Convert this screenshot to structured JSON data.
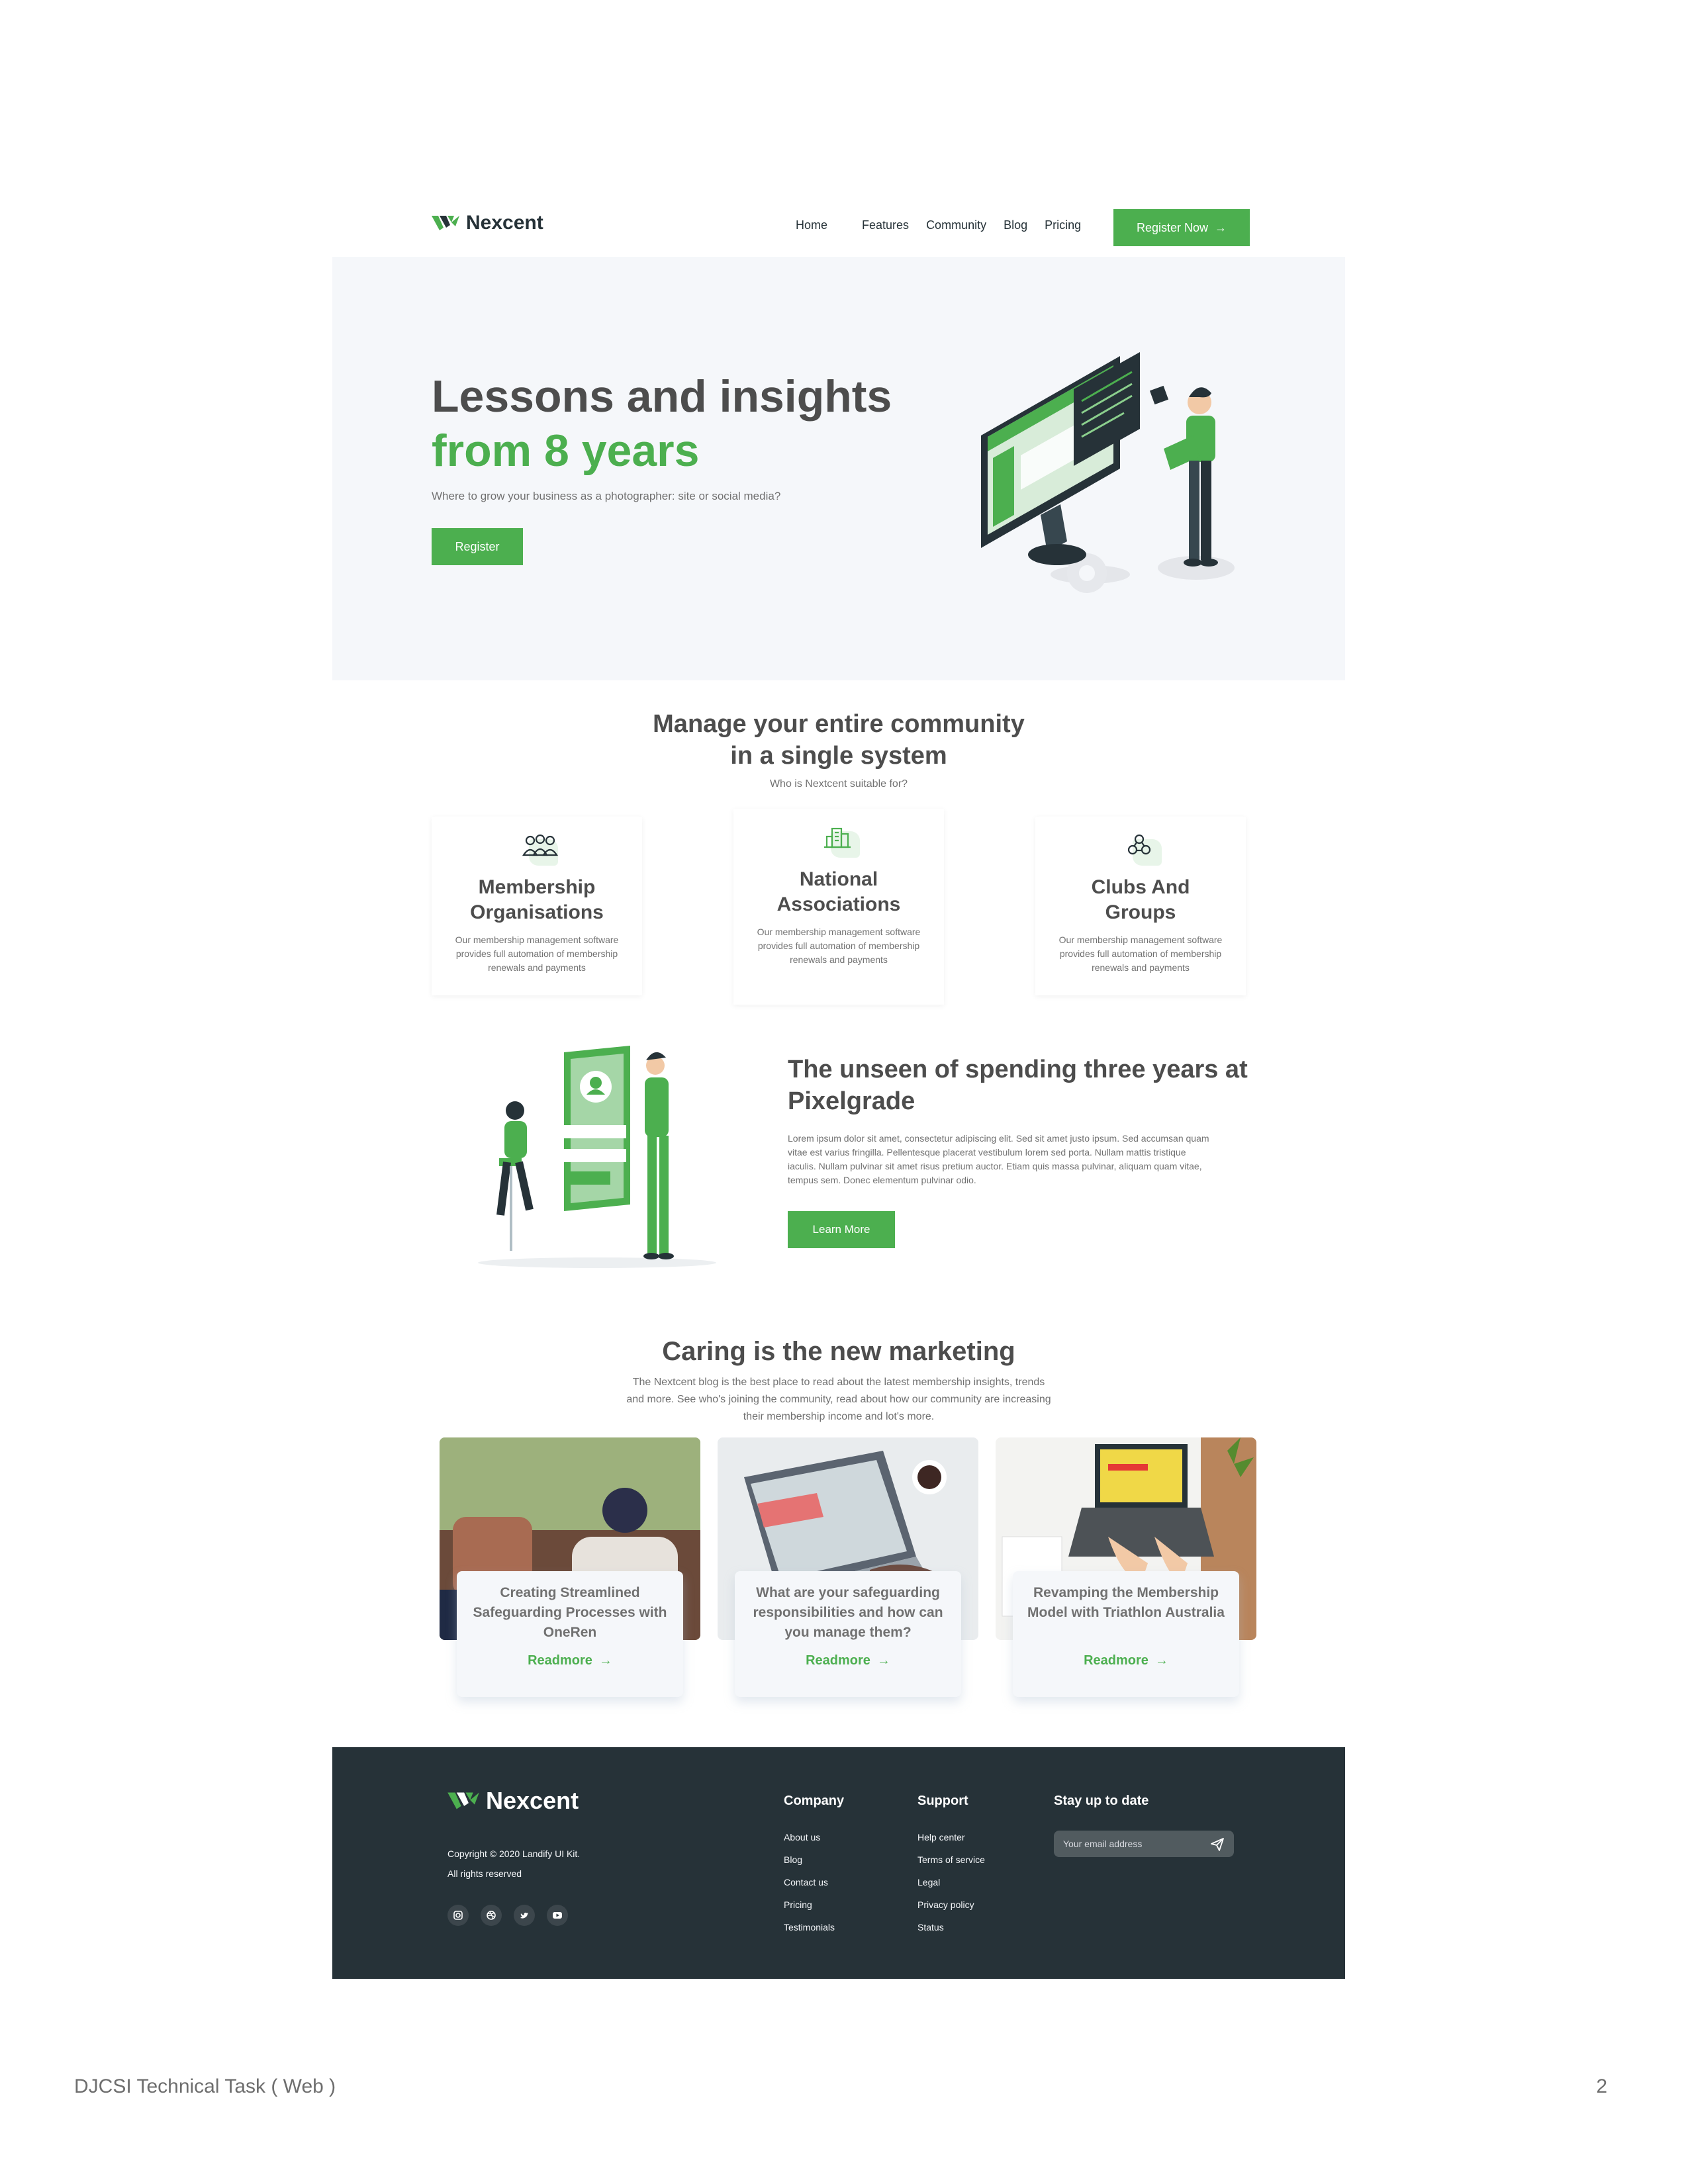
{
  "brand": {
    "name": "Nexcent",
    "accent": "#4caf4f",
    "dark": "#263238"
  },
  "nav": {
    "links": [
      "Home",
      "Features",
      "Community",
      "Blog",
      "Pricing"
    ],
    "cta": "Register Now",
    "cta_icon": "arrow-right-icon"
  },
  "hero": {
    "title_line1": "Lessons and insights",
    "title_line2": "from 8 years",
    "subtitle": "Where to grow your business as a photographer: site or social media?",
    "button": "Register"
  },
  "community": {
    "title_line1": "Manage your entire community",
    "title_line2": "in a single system",
    "subtitle": "Who is Nextcent suitable for?",
    "cards": [
      {
        "icon": "people-icon",
        "title": "Membership Organisations",
        "text": "Our membership management software provides full automation of membership renewals and payments"
      },
      {
        "icon": "building-icon",
        "title": "National Associations",
        "text": "Our membership management software provides full automation of membership renewals and payments"
      },
      {
        "icon": "group-icon",
        "title": "Clubs And Groups",
        "text": "Our membership management software provides full automation of membership renewals and payments"
      }
    ]
  },
  "unseen": {
    "title": "The unseen of spending three years at Pixelgrade",
    "text": "Lorem ipsum dolor sit amet, consectetur adipiscing elit. Sed sit amet justo ipsum. Sed accumsan quam vitae est varius fringilla. Pellentesque placerat vestibulum lorem sed porta. Nullam mattis tristique iaculis. Nullam pulvinar sit amet risus pretium auctor. Etiam quis massa pulvinar, aliquam quam vitae, tempus sem. Donec elementum pulvinar odio.",
    "button": "Learn More"
  },
  "caring": {
    "title": "Caring is the new marketing",
    "text": "The Nextcent blog is the best place to read about the latest membership insights, trends and more. See who's joining the community, read about how our community are increasing their membership income and lot's more.",
    "posts": [
      {
        "title": "Creating Streamlined Safeguarding Processes with OneRen",
        "link": "Readmore"
      },
      {
        "title": "What are your safeguarding responsibilities and how can you manage them?",
        "link": "Readmore"
      },
      {
        "title": "Revamping the Membership Model with Triathlon Australia",
        "link": "Readmore"
      }
    ]
  },
  "footer": {
    "brand": "Nexcent",
    "copyright": "Copyright © 2020 Landify UI Kit.",
    "rights": "All rights reserved",
    "social": [
      "instagram-icon",
      "dribbble-icon",
      "twitter-icon",
      "youtube-icon"
    ],
    "company": {
      "title": "Company",
      "links": [
        "About us",
        "Blog",
        "Contact us",
        "Pricing",
        "Testimonials"
      ]
    },
    "support": {
      "title": "Support",
      "links": [
        "Help center",
        "Terms of service",
        "Legal",
        "Privacy policy",
        "Status"
      ]
    },
    "newsletter": {
      "title": "Stay up to date",
      "placeholder": "Your email address",
      "send_icon": "send-icon"
    }
  },
  "document": {
    "caption": "DJCSI Technical Task ( Web )",
    "page": "2"
  }
}
